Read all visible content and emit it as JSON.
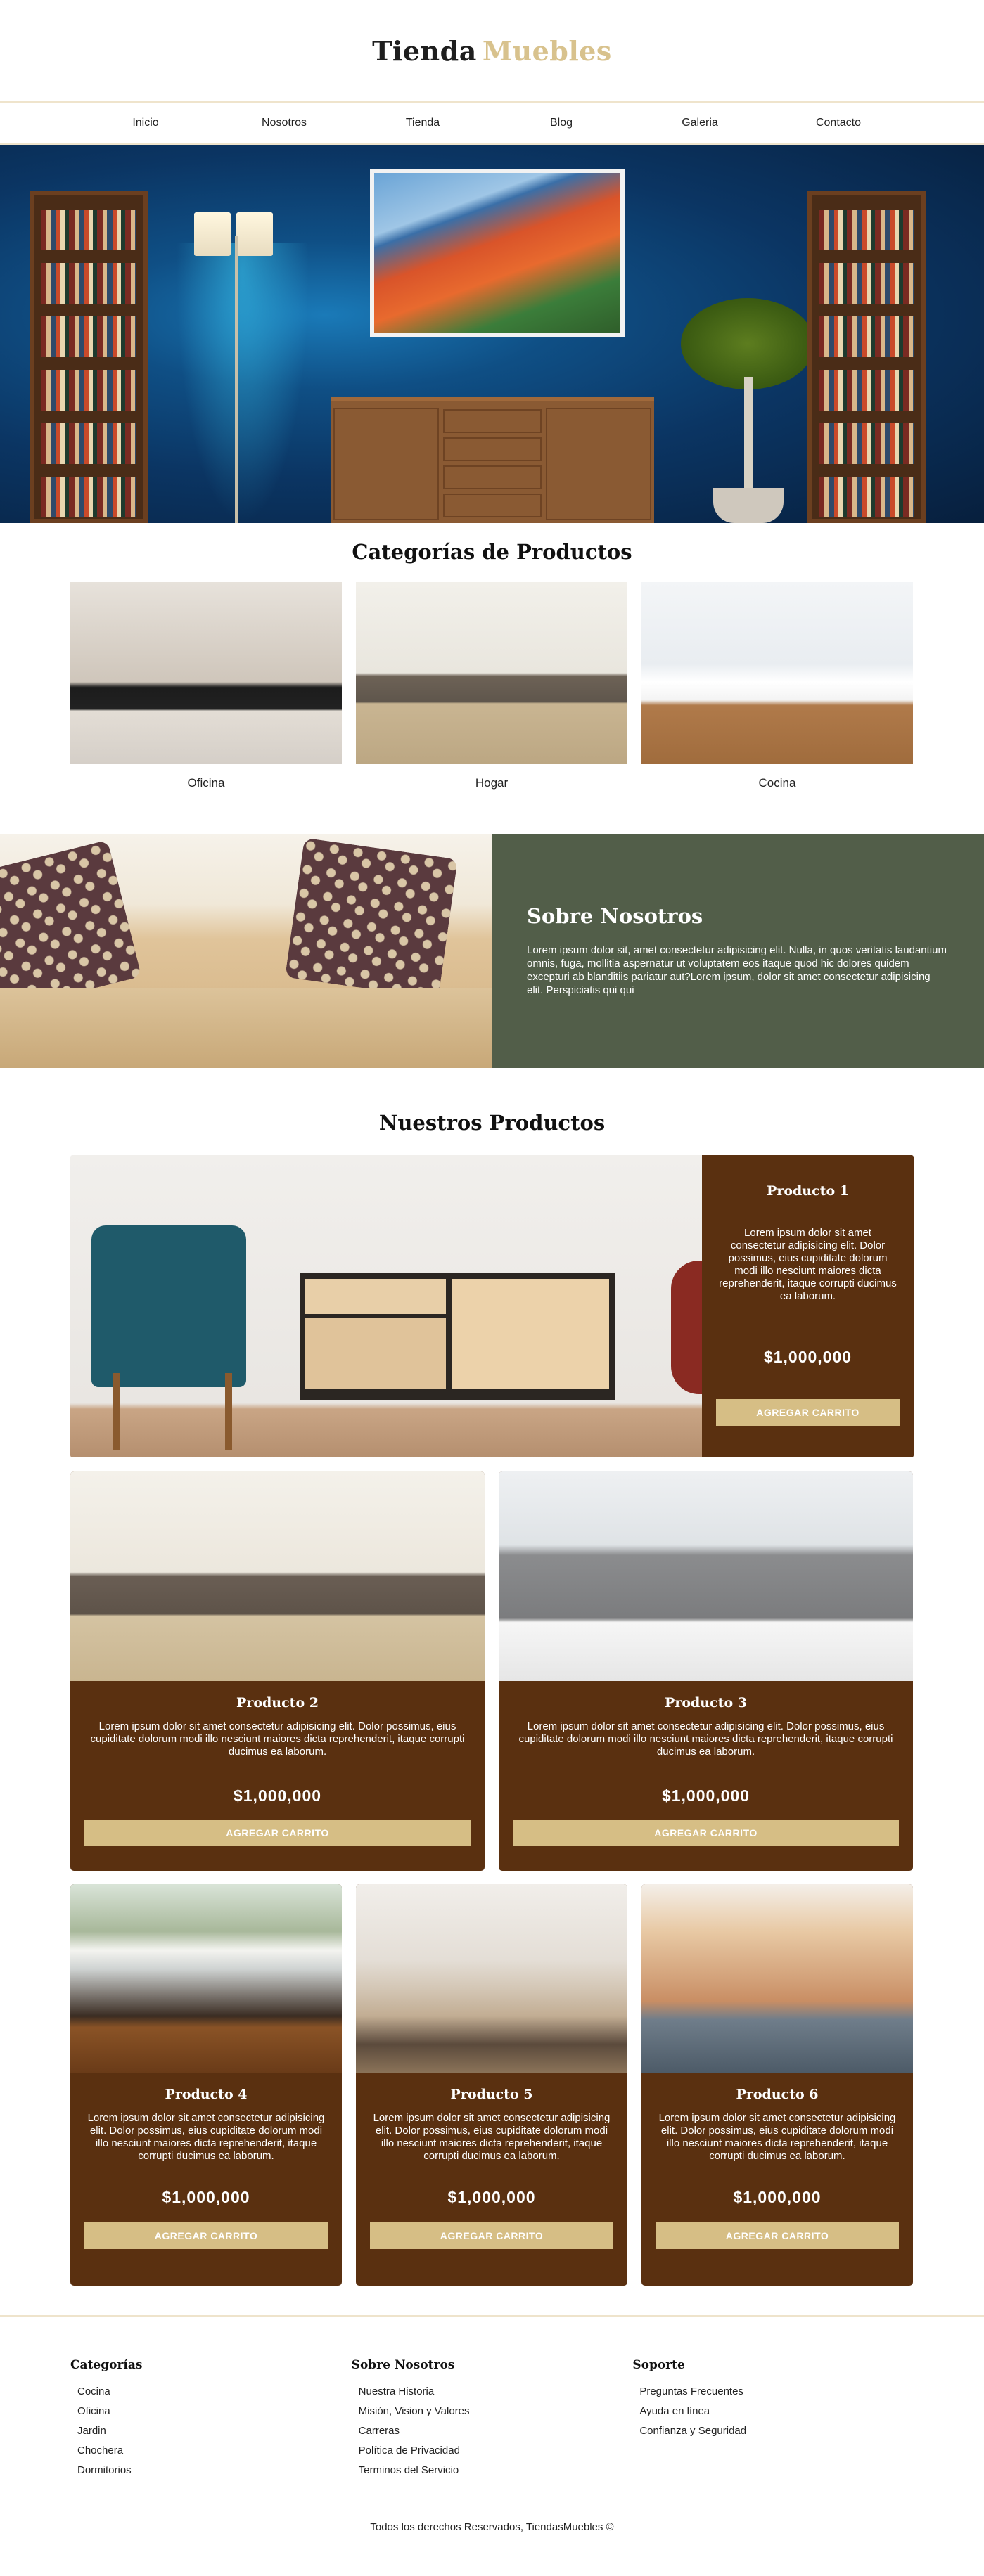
{
  "brand": {
    "part1": "Tienda",
    "part2": "Muebles"
  },
  "nav": [
    "Inicio",
    "Nosotros",
    "Tienda",
    "Blog",
    "Galeria",
    "Contacto"
  ],
  "categories": {
    "title": "Categorías de Productos",
    "items": [
      {
        "label": "Oficina"
      },
      {
        "label": "Hogar"
      },
      {
        "label": "Cocina"
      }
    ]
  },
  "about": {
    "title": "Sobre Nosotros",
    "text": "Lorem ipsum dolor sit, amet consectetur adipisicing elit. Nulla, in quos veritatis laudantium omnis, fuga, mollitia aspernatur ut voluptatem eos itaque quod hic dolores quidem excepturi ab blanditiis pariatur aut?Lorem ipsum, dolor sit amet consectetur adipisicing elit. Perspiciatis qui qui"
  },
  "products": {
    "title": "Nuestros Productos",
    "featured": {
      "name": "Producto 1",
      "desc": "Lorem ipsum dolor sit amet consectetur adipisicing elit. Dolor possimus, eius cupiditate dolorum modi illo nesciunt maiores dicta reprehenderit, itaque corrupti ducimus ea laborum.",
      "price": "$1,000,000",
      "button": "AGREGAR CARRITO"
    },
    "row2": [
      {
        "name": "Producto 2",
        "desc": "Lorem ipsum dolor sit amet consectetur adipisicing elit. Dolor possimus, eius cupiditate dolorum modi illo nesciunt maiores dicta reprehenderit, itaque corrupti ducimus ea laborum.",
        "price": "$1,000,000",
        "button": "AGREGAR CARRITO"
      },
      {
        "name": "Producto 3",
        "desc": "Lorem ipsum dolor sit amet consectetur adipisicing elit. Dolor possimus, eius cupiditate dolorum modi illo nesciunt maiores dicta reprehenderit, itaque corrupti ducimus ea laborum.",
        "price": "$1,000,000",
        "button": "AGREGAR CARRITO"
      }
    ],
    "row3": [
      {
        "name": "Producto 4",
        "desc": "Lorem ipsum dolor sit amet consectetur adipisicing elit. Dolor possimus, eius cupiditate dolorum modi illo nesciunt maiores dicta reprehenderit, itaque corrupti ducimus ea laborum.",
        "price": "$1,000,000",
        "button": "AGREGAR CARRITO"
      },
      {
        "name": "Producto 5",
        "desc": "Lorem ipsum dolor sit amet consectetur adipisicing elit. Dolor possimus, eius cupiditate dolorum modi illo nesciunt maiores dicta reprehenderit, itaque corrupti ducimus ea laborum.",
        "price": "$1,000,000",
        "button": "AGREGAR CARRITO"
      },
      {
        "name": "Producto 6",
        "desc": "Lorem ipsum dolor sit amet consectetur adipisicing elit. Dolor possimus, eius cupiditate dolorum modi illo nesciunt maiores dicta reprehenderit, itaque corrupti ducimus ea laborum.",
        "price": "$1,000,000",
        "button": "AGREGAR CARRITO"
      }
    ]
  },
  "footer": {
    "columns": [
      {
        "title": "Categorías",
        "links": [
          "Cocina",
          "Oficina",
          "Jardin",
          "Chochera",
          "Dormitorios"
        ]
      },
      {
        "title": "Sobre Nosotros",
        "links": [
          "Nuestra Historia",
          "Misión, Vision y Valores",
          "Carreras",
          "Política de Privacidad",
          "Terminos del Servicio"
        ]
      },
      {
        "title": "Soporte",
        "links": [
          "Preguntas Frecuentes",
          "Ayuda en línea",
          "Confianza y Seguridad"
        ]
      }
    ],
    "copyright": "Todos los derechos Reservados, TiendasMuebles ©"
  },
  "colors": {
    "gold": "#d8c28d",
    "brown": "#5a3010",
    "olive": "#525e49",
    "button": "#d6be85"
  }
}
